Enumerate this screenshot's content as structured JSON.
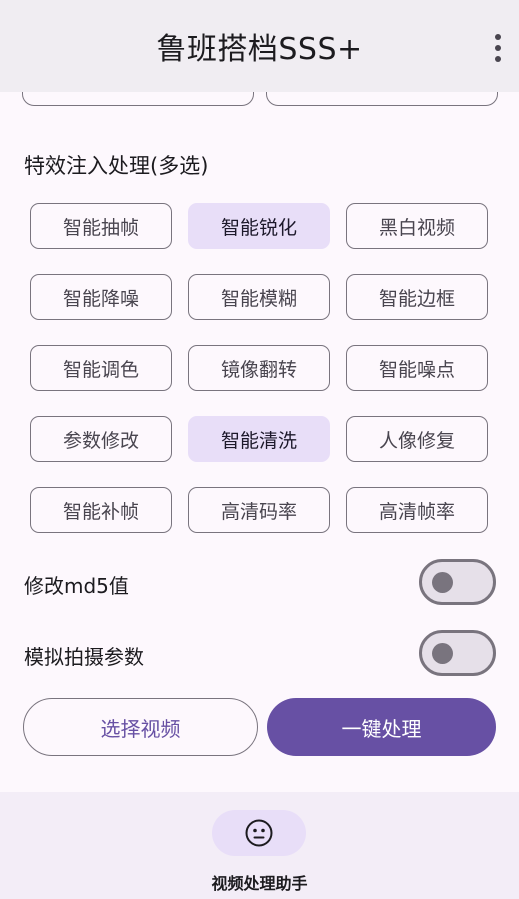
{
  "app": {
    "title": "鲁班搭档SSS+"
  },
  "effects": {
    "section_title": "特效注入处理(多选)",
    "chips": [
      {
        "label": "智能抽帧",
        "selected": false
      },
      {
        "label": "智能锐化",
        "selected": true
      },
      {
        "label": "黑白视频",
        "selected": false
      },
      {
        "label": "智能降噪",
        "selected": false
      },
      {
        "label": "智能模糊",
        "selected": false
      },
      {
        "label": "智能边框",
        "selected": false
      },
      {
        "label": "智能调色",
        "selected": false
      },
      {
        "label": "镜像翻转",
        "selected": false
      },
      {
        "label": "智能噪点",
        "selected": false
      },
      {
        "label": "参数修改",
        "selected": false
      },
      {
        "label": "智能清洗",
        "selected": true
      },
      {
        "label": "人像修复",
        "selected": false
      },
      {
        "label": "智能补帧",
        "selected": false
      },
      {
        "label": "高清码率",
        "selected": false
      },
      {
        "label": "高清帧率",
        "selected": false
      }
    ]
  },
  "toggles": [
    {
      "label": "修改md5值",
      "on": false
    },
    {
      "label": "模拟拍摄参数",
      "on": false
    }
  ],
  "actions": {
    "select_video": "选择视频",
    "process": "一键处理"
  },
  "bottom_nav": {
    "items": [
      {
        "label": "视频处理助手",
        "icon": "face-icon",
        "selected": true
      }
    ]
  },
  "colors": {
    "primary": "#6750a4",
    "chip_selected": "#e8def8",
    "surface": "#fdf8fd",
    "appbar": "#f0edf2"
  }
}
